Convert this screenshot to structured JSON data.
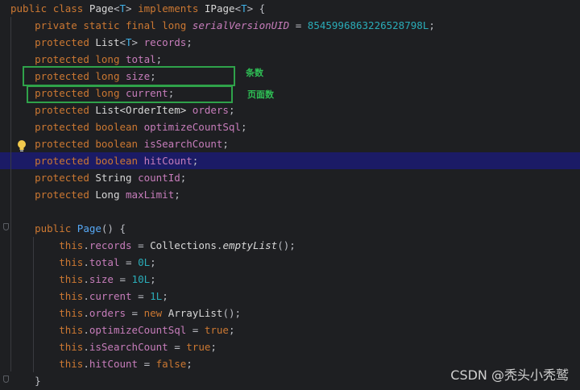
{
  "code_lines": [
    [
      [
        "kw",
        "public"
      ],
      [
        "sp",
        " "
      ],
      [
        "kw",
        "class"
      ],
      [
        "sp",
        " "
      ],
      [
        "type",
        "Page"
      ],
      [
        "punct",
        "<"
      ],
      [
        "typeparam",
        "T"
      ],
      [
        "punct",
        ">"
      ],
      [
        "sp",
        " "
      ],
      [
        "kw",
        "implements"
      ],
      [
        "sp",
        " "
      ],
      [
        "type",
        "IPage"
      ],
      [
        "punct",
        "<"
      ],
      [
        "typeparam",
        "T"
      ],
      [
        "punct",
        "> {"
      ]
    ],
    [
      [
        "sp",
        "    "
      ],
      [
        "kw",
        "private static final long"
      ],
      [
        "sp",
        " "
      ],
      [
        "const",
        "serialVersionUID"
      ],
      [
        "punct",
        " = "
      ],
      [
        "num",
        "8545996863226528798L"
      ],
      [
        "punct",
        ";"
      ]
    ],
    [
      [
        "sp",
        "    "
      ],
      [
        "kw",
        "protected"
      ],
      [
        "sp",
        " "
      ],
      [
        "type",
        "List"
      ],
      [
        "punct",
        "<"
      ],
      [
        "typeparam",
        "T"
      ],
      [
        "punct",
        "> "
      ],
      [
        "field",
        "records"
      ],
      [
        "punct",
        ";"
      ]
    ],
    [
      [
        "sp",
        "    "
      ],
      [
        "kw",
        "protected long"
      ],
      [
        "sp",
        " "
      ],
      [
        "field",
        "total"
      ],
      [
        "punct",
        ";"
      ]
    ],
    [
      [
        "sp",
        "    "
      ],
      [
        "kw",
        "protected long"
      ],
      [
        "sp",
        " "
      ],
      [
        "field",
        "size"
      ],
      [
        "punct",
        ";"
      ]
    ],
    [
      [
        "sp",
        "    "
      ],
      [
        "kw",
        "protected long"
      ],
      [
        "sp",
        " "
      ],
      [
        "field",
        "current"
      ],
      [
        "punct",
        ";"
      ]
    ],
    [
      [
        "sp",
        "    "
      ],
      [
        "kw",
        "protected"
      ],
      [
        "sp",
        " "
      ],
      [
        "type",
        "List<OrderItem>"
      ],
      [
        "sp",
        " "
      ],
      [
        "field",
        "orders"
      ],
      [
        "punct",
        ";"
      ]
    ],
    [
      [
        "sp",
        "    "
      ],
      [
        "kw",
        "protected boolean"
      ],
      [
        "sp",
        " "
      ],
      [
        "field",
        "optimizeCountSql"
      ],
      [
        "punct",
        ";"
      ]
    ],
    [
      [
        "sp",
        "    "
      ],
      [
        "kw",
        "protected boolean"
      ],
      [
        "sp",
        " "
      ],
      [
        "field",
        "isSearchCount"
      ],
      [
        "punct",
        ";"
      ]
    ],
    [
      [
        "sp",
        "    "
      ],
      [
        "kw",
        "protected boolean"
      ],
      [
        "sp",
        " "
      ],
      [
        "field",
        "hitCount"
      ],
      [
        "punct",
        ";"
      ]
    ],
    [
      [
        "sp",
        "    "
      ],
      [
        "kw",
        "protected"
      ],
      [
        "sp",
        " "
      ],
      [
        "type",
        "String"
      ],
      [
        "sp",
        " "
      ],
      [
        "field",
        "countId"
      ],
      [
        "punct",
        ";"
      ]
    ],
    [
      [
        "sp",
        "    "
      ],
      [
        "kw",
        "protected"
      ],
      [
        "sp",
        " "
      ],
      [
        "type",
        "Long"
      ],
      [
        "sp",
        " "
      ],
      [
        "field",
        "maxLimit"
      ],
      [
        "punct",
        ";"
      ]
    ],
    [],
    [
      [
        "sp",
        "    "
      ],
      [
        "kw",
        "public"
      ],
      [
        "sp",
        " "
      ],
      [
        "method",
        "Page"
      ],
      [
        "punct",
        "() {"
      ]
    ],
    [
      [
        "sp",
        "        "
      ],
      [
        "kw",
        "this"
      ],
      [
        "punct",
        "."
      ],
      [
        "field",
        "records"
      ],
      [
        "punct",
        " = "
      ],
      [
        "type",
        "Collections"
      ],
      [
        "punct",
        "."
      ],
      [
        "static-call",
        "emptyList"
      ],
      [
        "punct",
        "();"
      ]
    ],
    [
      [
        "sp",
        "        "
      ],
      [
        "kw",
        "this"
      ],
      [
        "punct",
        "."
      ],
      [
        "field",
        "total"
      ],
      [
        "punct",
        " = "
      ],
      [
        "num",
        "0L"
      ],
      [
        "punct",
        ";"
      ]
    ],
    [
      [
        "sp",
        "        "
      ],
      [
        "kw",
        "this"
      ],
      [
        "punct",
        "."
      ],
      [
        "field",
        "size"
      ],
      [
        "punct",
        " = "
      ],
      [
        "num",
        "10L"
      ],
      [
        "punct",
        ";"
      ]
    ],
    [
      [
        "sp",
        "        "
      ],
      [
        "kw",
        "this"
      ],
      [
        "punct",
        "."
      ],
      [
        "field",
        "current"
      ],
      [
        "punct",
        " = "
      ],
      [
        "num",
        "1L"
      ],
      [
        "punct",
        ";"
      ]
    ],
    [
      [
        "sp",
        "        "
      ],
      [
        "kw",
        "this"
      ],
      [
        "punct",
        "."
      ],
      [
        "field",
        "orders"
      ],
      [
        "punct",
        " = "
      ],
      [
        "kw",
        "new"
      ],
      [
        "sp",
        " "
      ],
      [
        "type",
        "ArrayList"
      ],
      [
        "punct",
        "();"
      ]
    ],
    [
      [
        "sp",
        "        "
      ],
      [
        "kw",
        "this"
      ],
      [
        "punct",
        "."
      ],
      [
        "field",
        "optimizeCountSql"
      ],
      [
        "punct",
        " = "
      ],
      [
        "kw",
        "true"
      ],
      [
        "punct",
        ";"
      ]
    ],
    [
      [
        "sp",
        "        "
      ],
      [
        "kw",
        "this"
      ],
      [
        "punct",
        "."
      ],
      [
        "field",
        "isSearchCount"
      ],
      [
        "punct",
        " = "
      ],
      [
        "kw",
        "true"
      ],
      [
        "punct",
        ";"
      ]
    ],
    [
      [
        "sp",
        "        "
      ],
      [
        "kw",
        "this"
      ],
      [
        "punct",
        "."
      ],
      [
        "field",
        "hitCount"
      ],
      [
        "punct",
        " = "
      ],
      [
        "kw",
        "false"
      ],
      [
        "punct",
        ";"
      ]
    ],
    [
      [
        "sp",
        "    "
      ],
      [
        "punct",
        "}"
      ]
    ]
  ],
  "highlighted_line": 9,
  "annotations": {
    "size_label": "条数",
    "current_label": "页面数"
  },
  "watermark": "CSDN @秃头小秃鹫",
  "icons": {
    "bulb": "lightbulb-icon",
    "fold": "fold-icon"
  },
  "colors": {
    "background": "#1e1f22",
    "keyword": "#cc7832",
    "field": "#c77dbb",
    "number": "#2aacb8",
    "type_param": "#3fb0e6",
    "highlight": "#1b1b66",
    "annotation": "#2fa24a"
  }
}
